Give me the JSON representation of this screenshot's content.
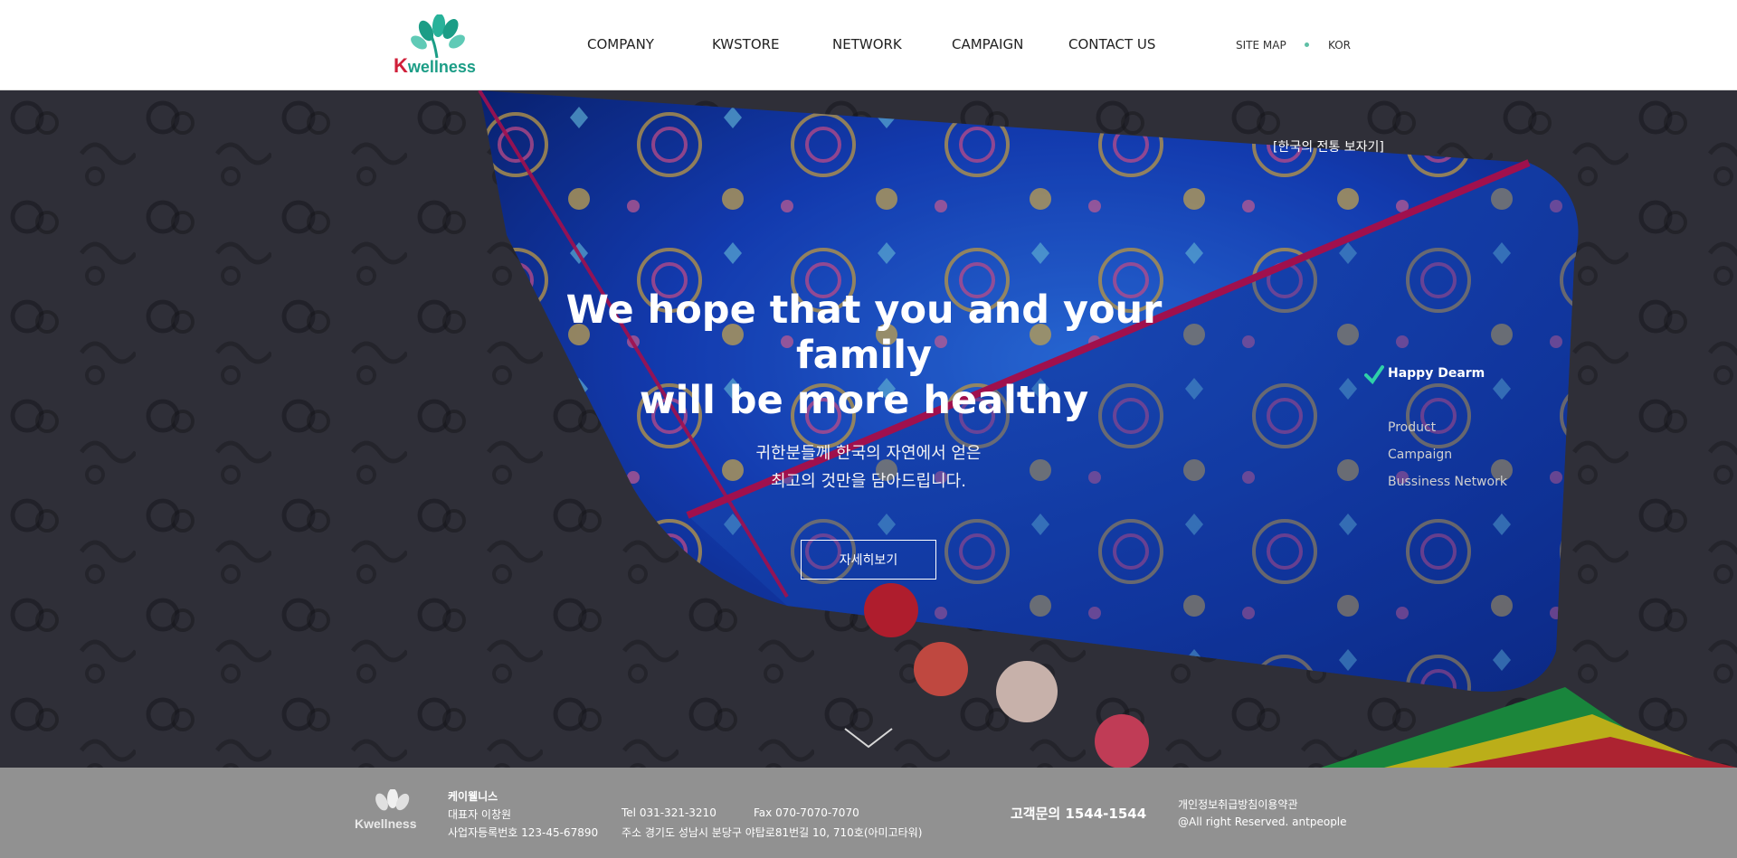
{
  "brand": {
    "logo_text_k": "K",
    "logo_text_rest": "wellness",
    "accent": "#1b9d86",
    "logo_red": "#d0203a"
  },
  "header": {
    "nav": [
      "COMPANY",
      "KWSTORE",
      "NETWORK",
      "CAMPAIGN",
      "CONTACT US"
    ],
    "utility": {
      "sitemap": "SITE MAP",
      "language": "KOR"
    }
  },
  "hero": {
    "korean_tradition_link": "[한국의 전통 보자기]",
    "headline_line1": "We hope that you and your family",
    "headline_line2": "will be more healthy",
    "sub_line1": "귀한분들께 한국의 자연에서 얻은",
    "sub_line2": "최고의 것만을 담아드립니다.",
    "more_button": "자세히보기",
    "side_menu": {
      "title": "Happy Dearm",
      "items": [
        "Product",
        "Campaign",
        "Bussiness Network"
      ]
    },
    "colors": {
      "silk_blue": "#1a4fd8",
      "magenta": "#c4145f"
    }
  },
  "footer": {
    "company_name": "케이웰니스",
    "ceo": "대표자 이창원",
    "business_no": "사업자등록번호 123-45-67890",
    "tel": "Tel 031-321-3210",
    "fax": "Fax 070-7070-7070",
    "address": "주소 경기도 성남시 분당구 야탑로81번길 10, 710호(아미고타워)",
    "customer_center": "고객문의 1544-1544",
    "privacy": "개인정보취급방침이용약관",
    "copyright": "@All right Reserved. antpeople",
    "logo_text": "Kwellness"
  }
}
